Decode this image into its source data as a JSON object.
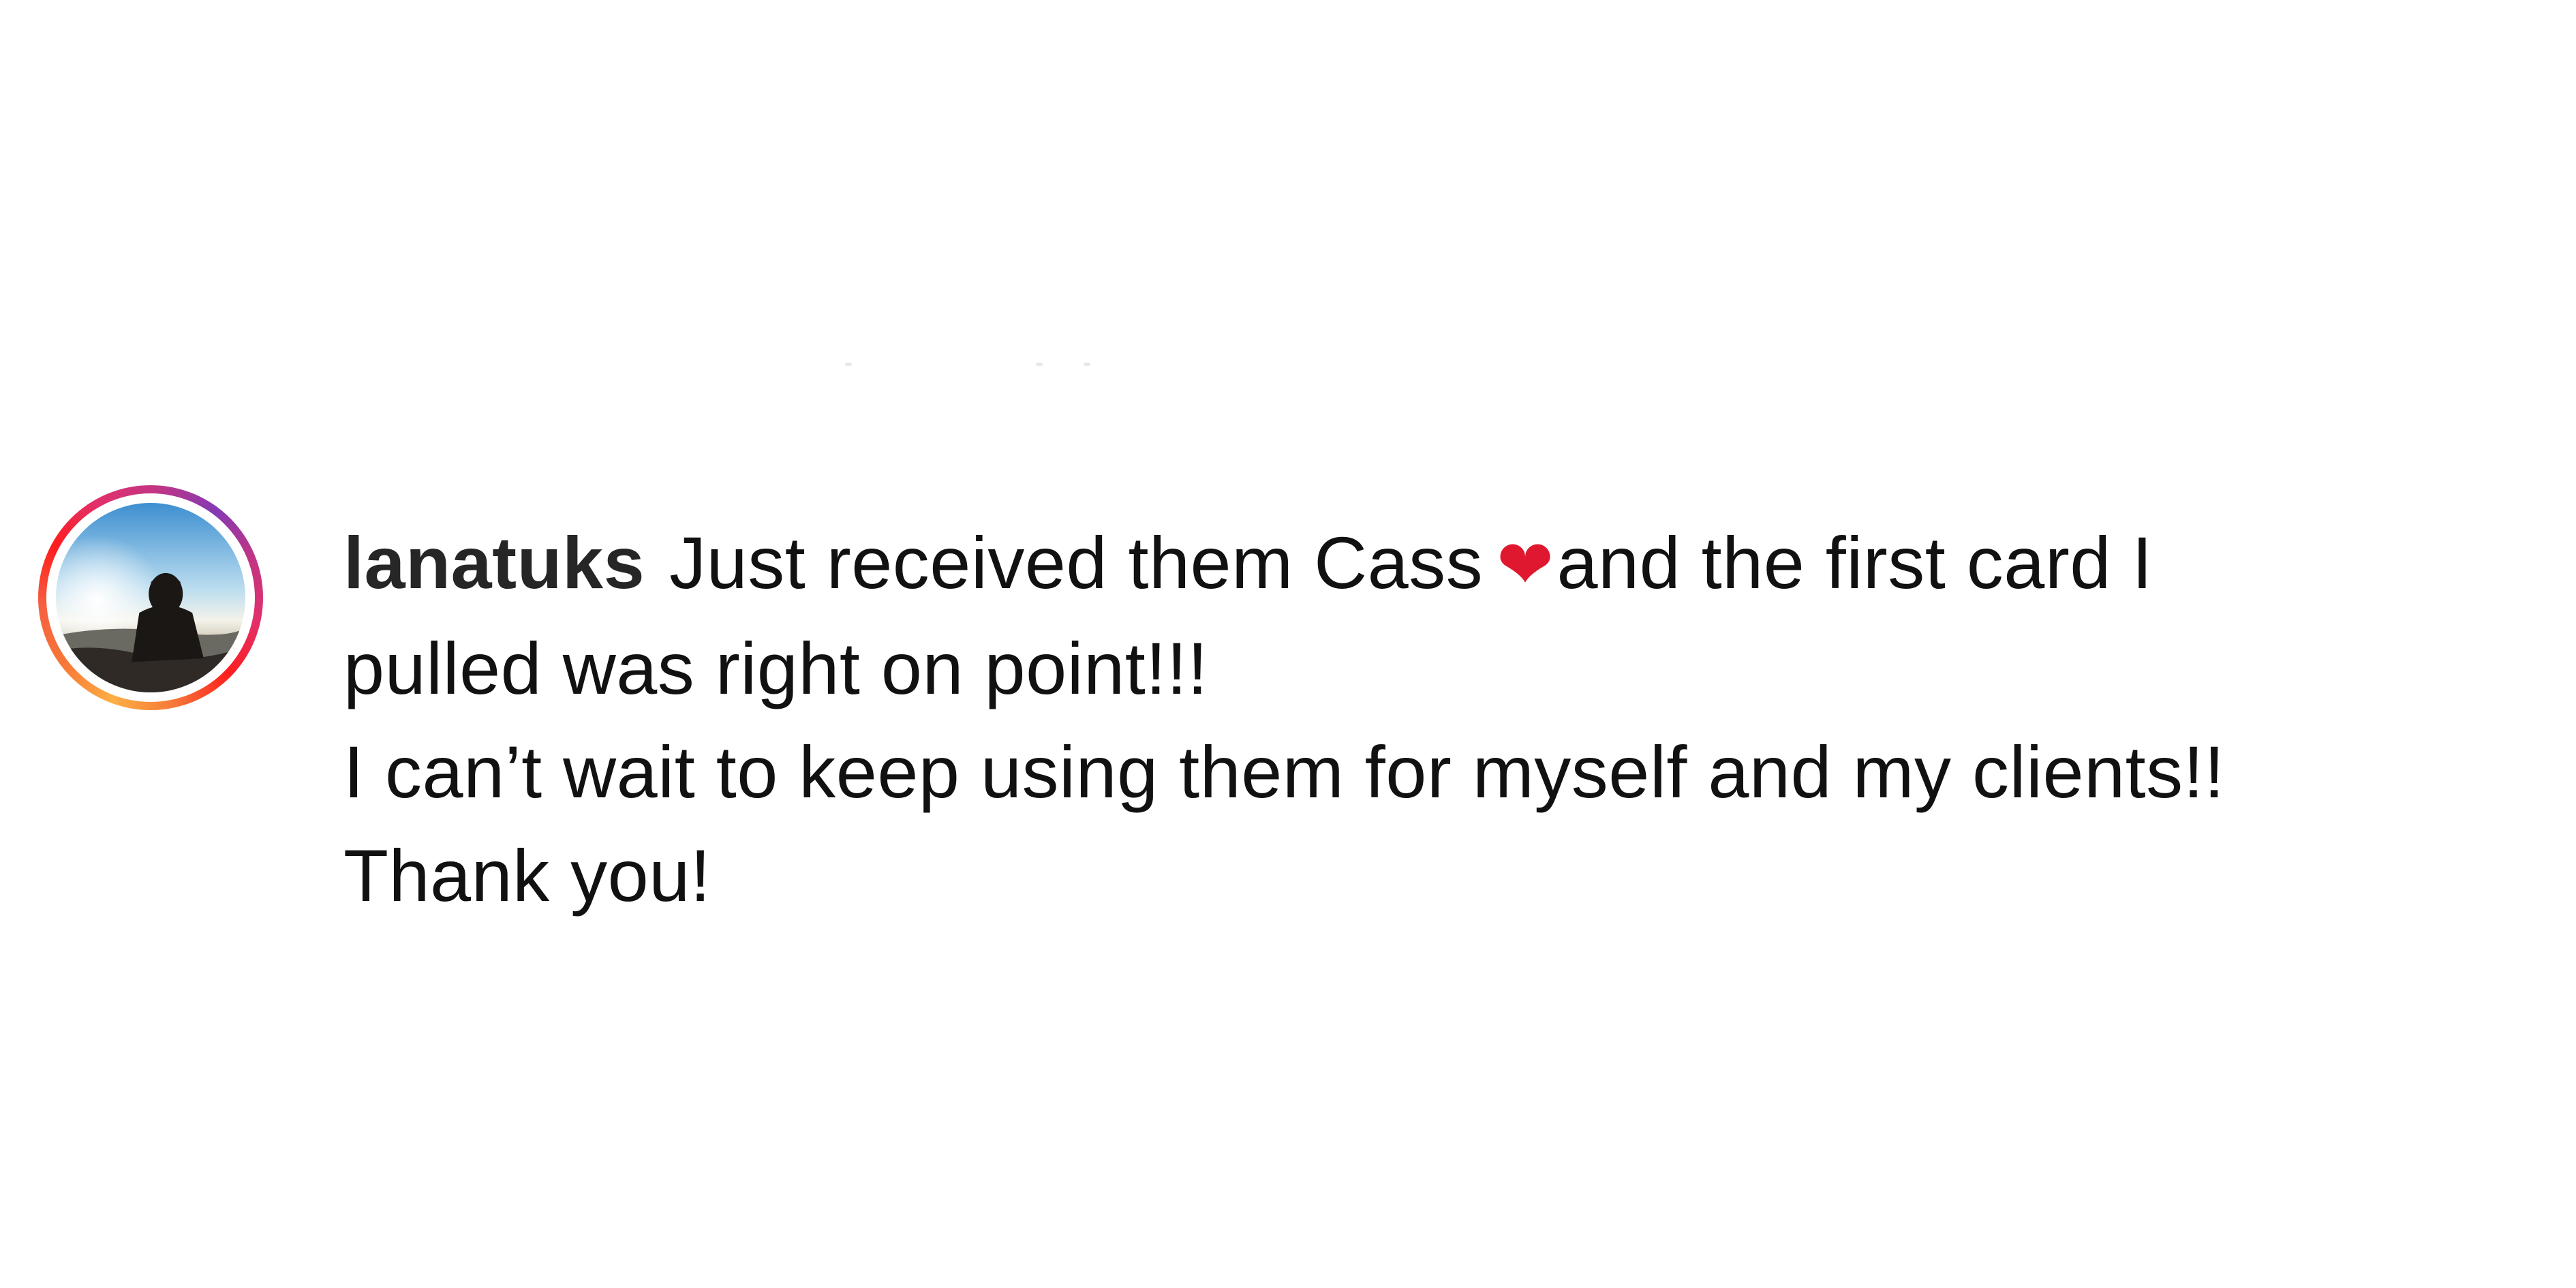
{
  "comment": {
    "username": "lanatuks",
    "line1_a": "Just received them Cass",
    "heart_glyph": "❤",
    "line1_b": "and the first card I",
    "line2": "pulled was right on point!!!",
    "line3": "I can’t wait to keep using them for myself and my clients!!",
    "line4": "Thank you!"
  },
  "avatar": {
    "icon": "user-profile-photo",
    "ring_colors": [
      "#fcaf45",
      "#f77737",
      "#fd1d1d",
      "#e1306c",
      "#c13584",
      "#833ab4"
    ]
  },
  "colors": {
    "text": "#111111",
    "username": "#262626",
    "heart": "#e0182f",
    "background": "#ffffff"
  }
}
